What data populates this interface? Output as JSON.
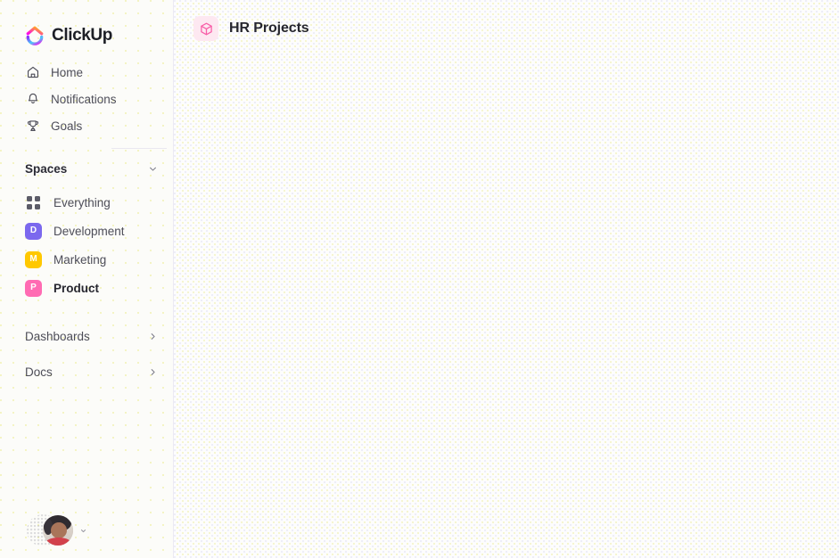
{
  "brand": {
    "name": "ClickUp",
    "logo_icon": "clickup-logo-icon",
    "logo_colors": [
      "#FF02F0",
      "#FA12E3",
      "#7B68EE",
      "#49CCF9"
    ]
  },
  "sidebar": {
    "nav_top": [
      {
        "label": "Home",
        "icon": "home-icon"
      },
      {
        "label": "Notifications",
        "icon": "bell-icon"
      },
      {
        "label": "Goals",
        "icon": "trophy-icon"
      }
    ],
    "spaces_section": {
      "title": "Spaces",
      "collapse_icon": "chevron-down-icon"
    },
    "spaces": [
      {
        "label": "Everything",
        "icon": "grid-dots-icon",
        "badge": "",
        "color": "",
        "active": false
      },
      {
        "label": "Development",
        "icon": "",
        "badge": "D",
        "color": "#7B68EE",
        "active": false
      },
      {
        "label": "Marketing",
        "icon": "",
        "badge": "M",
        "color": "#FFC800",
        "active": false
      },
      {
        "label": "Product",
        "icon": "",
        "badge": "P",
        "color": "#FF6BB3",
        "active": true
      }
    ],
    "nav_groups": [
      {
        "label": "Dashboards",
        "icon": "chevron-right-icon"
      },
      {
        "label": "Docs",
        "icon": "chevron-right-icon"
      }
    ],
    "user": {
      "avatar_icon": "user-avatar",
      "menu_icon": "chevron-down-small-icon"
    }
  },
  "header": {
    "title": "HR Projects",
    "icon": "cube-icon",
    "icon_color": "#F85FA8",
    "icon_bg": "#FDE8F1"
  },
  "main": {
    "content": ""
  }
}
